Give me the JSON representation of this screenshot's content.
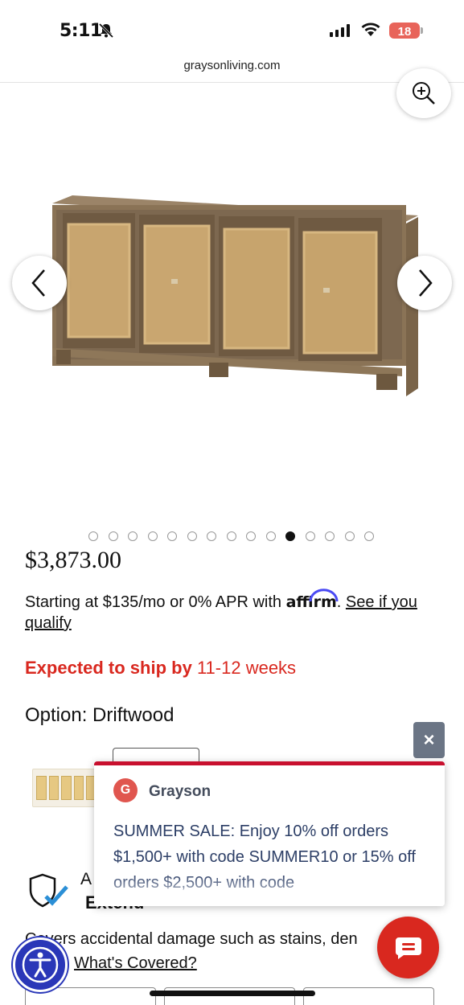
{
  "status_bar": {
    "time": "5:11",
    "battery": "18",
    "battery_color": "#e8645a"
  },
  "browser": {
    "url": "graysonliving.com"
  },
  "gallery": {
    "dot_count": 15,
    "active_dot": 10,
    "icons": [
      "zoom-in-icon",
      "chevron-left-icon",
      "chevron-right-icon"
    ]
  },
  "product": {
    "price": "$3,873.00",
    "financing_prefix": "Starting at $135/mo or 0% APR with ",
    "affirm_logo": "affirm",
    "financing_link": "See if you qualify",
    "ship_label": "Expected to ship by",
    "ship_value": "11-12 weeks",
    "option_label": "Option: Driftwood"
  },
  "protection": {
    "title_a": "A",
    "title_extend": "Extend",
    "covers_text": "Covers accidental damage such as stains, den",
    "whats_covered": "What's Covered?"
  },
  "popup": {
    "avatar_letter": "G",
    "sender": "Grayson",
    "message": "SUMMER SALE: Enjoy 10% off orders $1,500+ with code SUMMER10 or 15% off orders $2,500+ with code",
    "close_label": "×",
    "accent_color": "#c8102e"
  },
  "colors": {
    "ship_red": "#d9281f",
    "chat_button": "#d9281f",
    "accessibility_button": "#2a37b8"
  }
}
